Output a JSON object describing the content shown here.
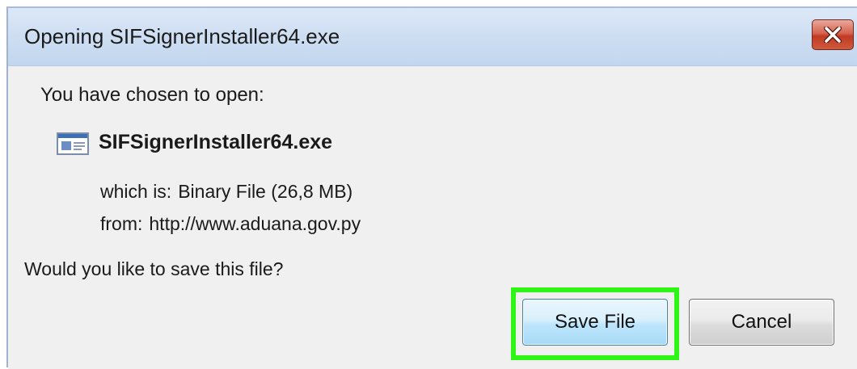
{
  "dialog": {
    "title": "Opening SIFSignerInstaller64.exe",
    "intro": "You have chosen to open:",
    "file_name": "SIFSignerInstaller64.exe",
    "type_key": "which is:",
    "type_value": "Binary File (26,8 MB)",
    "from_key": "from:",
    "from_value": "http://www.aduana.gov.py",
    "question": "Would you like to save this file?",
    "save_label": "Save File",
    "cancel_label": "Cancel"
  },
  "icons": {
    "close": "close-icon",
    "file": "file-icon"
  },
  "colors": {
    "titlebar": "#cfdff2",
    "close_button": "#c13a22",
    "highlight": "#2ef516",
    "dialog_bg": "#f0f0f0"
  }
}
